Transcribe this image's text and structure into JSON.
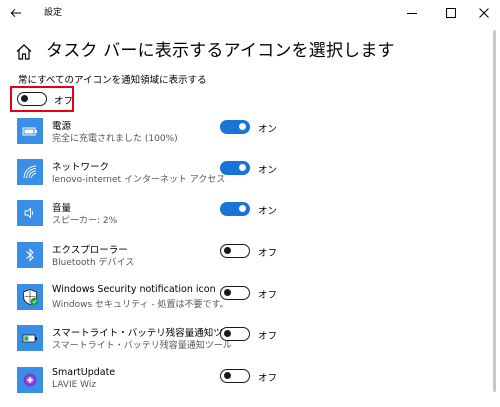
{
  "window": {
    "title": "設定"
  },
  "page": {
    "title": "タスク バーに表示するアイコンを選択します",
    "always_show": {
      "label": "常にすべてのアイコンを通知領域に表示する",
      "state": "オフ",
      "on": false
    }
  },
  "items": [
    {
      "name": "電源",
      "desc": "完全に充電されました (100%)",
      "state": "オン",
      "on": true,
      "icon": "battery-icon"
    },
    {
      "name": "ネットワーク",
      "desc": "lenovo-internet インターネット アクセス",
      "state": "オン",
      "on": true,
      "icon": "wifi-icon"
    },
    {
      "name": "音量",
      "desc": "スピーカー: 2%",
      "state": "オン",
      "on": true,
      "icon": "speaker-icon"
    },
    {
      "name": "エクスプローラー",
      "desc": "Bluetooth デバイス",
      "state": "オフ",
      "on": false,
      "icon": "bluetooth-icon"
    },
    {
      "name": "Windows Security notification icon",
      "desc": "Windows セキュリティ - 処置は不要です。",
      "state": "オフ",
      "on": false,
      "icon": "shield-icon"
    },
    {
      "name": "スマートライト・バッテリ残容量通知ツール",
      "desc": "スマートライト・バッテリ残容量通知ツール",
      "state": "オフ",
      "on": false,
      "icon": "battery-status-icon"
    },
    {
      "name": "SmartUpdate",
      "desc": "LAVIE Wiz",
      "state": "オフ",
      "on": false,
      "icon": "smartupdate-icon"
    }
  ],
  "colors": {
    "accent": "#1a73d8",
    "icon_bg": "#3a8ee6",
    "highlight": "#e60012"
  }
}
